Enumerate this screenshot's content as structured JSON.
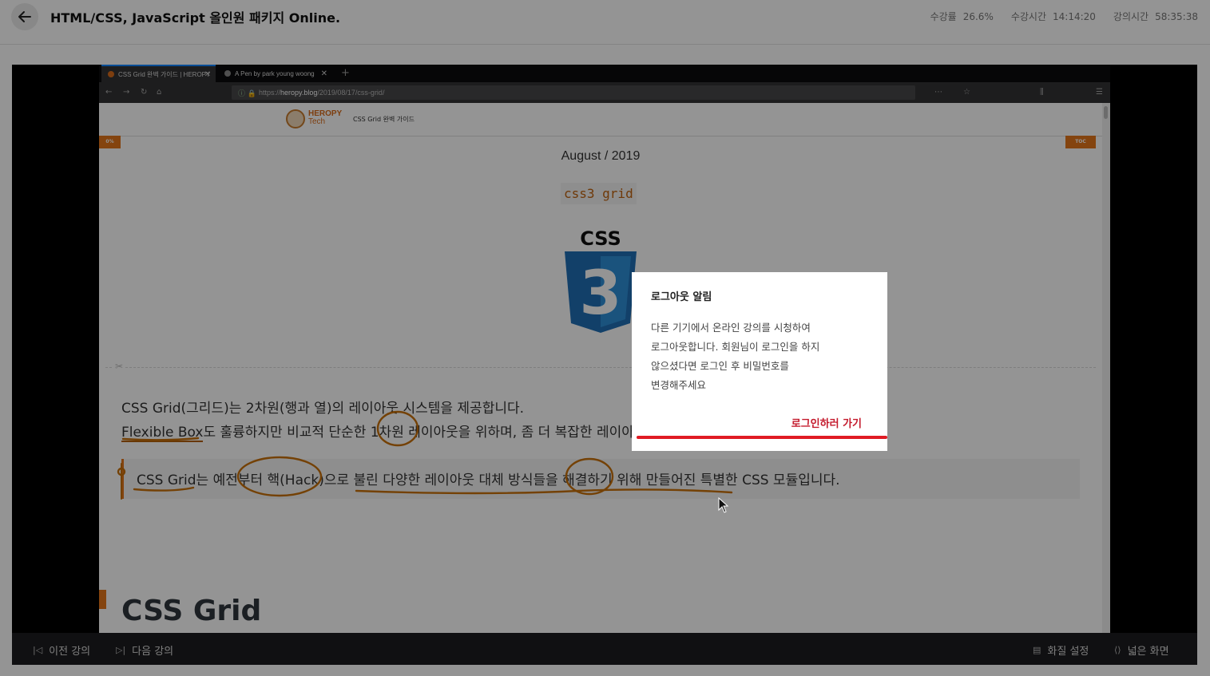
{
  "header": {
    "course_title": "HTML/CSS, JavaScript 올인원 패키지 Online.",
    "stats": [
      {
        "label": "수강률",
        "value": "26.6%"
      },
      {
        "label": "수강시간",
        "value": "14:14:20"
      },
      {
        "label": "강의시간",
        "value": "58:35:38"
      }
    ],
    "back_icon": "arrow-left-icon"
  },
  "video": {
    "browser": {
      "tabs": [
        {
          "label": "CSS Grid 완벽 가이드 | HEROPY",
          "active": true
        },
        {
          "label": "A Pen by park young woong",
          "active": false
        }
      ],
      "url_prefix": "https://",
      "url_host": "heropy.blog",
      "url_path": "/2019/08/17/css-grid/"
    },
    "site": {
      "logo_line1": "HEROPY",
      "logo_line2": "Tech",
      "site_title": "CSS Grid 완벽 가이드",
      "progress_badge": "0%",
      "toc_badge": "TOC",
      "date": "August / 2019",
      "tag": "css3 grid",
      "css_logo_text": "CSS",
      "css_logo_number": "3",
      "para1": "CSS Grid(그리드)는 2차원(행과 열)의 레이아웃 시스템을 제공합니다.",
      "para2_link": "Flexible Box",
      "para2_rest": "도 훌륭하지만 비교적 단순한 1차원 레이아웃을 위하며, 좀 더 복잡한 레이아웃을 위해 CSS Grid를 사용할 수 있습니다.",
      "quote": "CSS Grid는 예전부터 핵(Hack)으로 불린 다양한 레이아웃 대체 방식들을 해결하기 위해 만들어진 특별한 CSS 모듈입니다.",
      "heading": "CSS Grid"
    }
  },
  "controls": {
    "prev": "이전 강의",
    "next": "다음 강의",
    "quality": "화질 설정",
    "wide": "넓은 화면"
  },
  "modal": {
    "title": "로그아웃 알림",
    "body_lines": [
      "다른 기기에서 온라인 강의를 시청하여",
      "로그아웃합니다. 회원님이 로그인을 하지",
      "않으셨다면 로그인 후 비밀번호를",
      "변경해주세요"
    ],
    "action": "로그인하러 가기"
  },
  "colors": {
    "accent_orange": "#e4761a",
    "annotation": "#c8700a",
    "link_red": "#c41a2c",
    "underline_red": "#e01b24"
  }
}
